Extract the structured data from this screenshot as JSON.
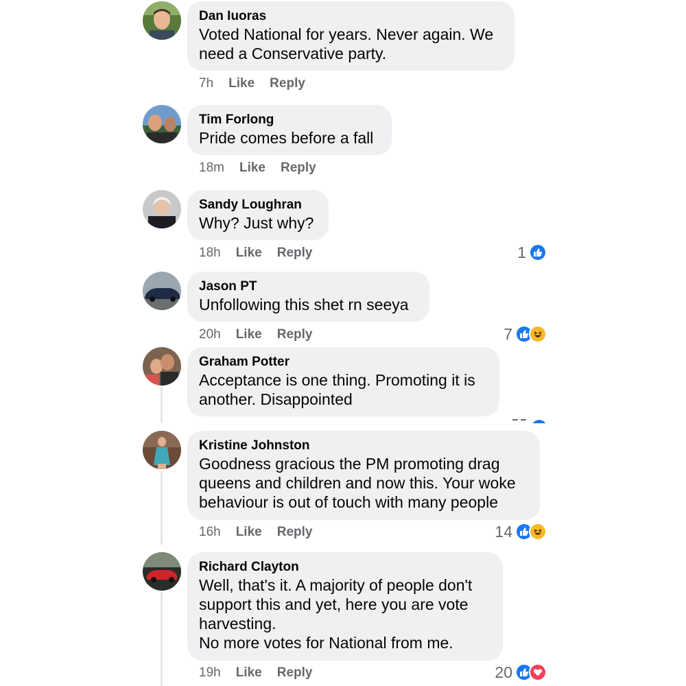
{
  "actions": {
    "like": "Like",
    "reply": "Reply"
  },
  "colors": {
    "like": "#1877f2",
    "haha": "#f7b928",
    "love": "#f33e58",
    "bubble": "#eff0f2",
    "meta": "#65676b"
  },
  "comments": [
    {
      "author": "Dan Iuoras",
      "text": "Voted National for years. Never again. We\nneed a Conservative party.",
      "time": "7h",
      "reactions": null
    },
    {
      "author": "Tim Forlong",
      "text": "Pride comes before a fall",
      "time": "18m",
      "reactions": null
    },
    {
      "author": "Sandy Loughran",
      "text": "Why? Just why?",
      "time": "18h",
      "reactions": {
        "count": "1",
        "icons": [
          "like-icon"
        ]
      }
    },
    {
      "author": "Jason PT",
      "text": "Unfollowing this shet rn seeya",
      "time": "20h",
      "reactions": {
        "count": "7",
        "icons": [
          "like-icon",
          "haha-icon"
        ]
      }
    },
    {
      "author": "Graham Potter",
      "text": "Acceptance is one thing. Promoting it is\nanother. Disappointed",
      "time": "",
      "reactions": null
    },
    {
      "author": "Kristine Johnston",
      "text": "Goodness gracious the PM promoting drag\nqueens and children and now this. Your woke\nbehaviour is out of touch with many people",
      "time": "16h",
      "reactions": {
        "count": "14",
        "icons": [
          "like-icon",
          "haha-icon"
        ]
      }
    },
    {
      "author": "Richard Clayton",
      "text": "Well, that's it. A majority of people don't\nsupport this and yet, here you are vote\nharvesting.\nNo more votes for National from me.",
      "time": "19h",
      "reactions": {
        "count": "20",
        "icons": [
          "like-icon",
          "love-icon"
        ]
      }
    }
  ]
}
